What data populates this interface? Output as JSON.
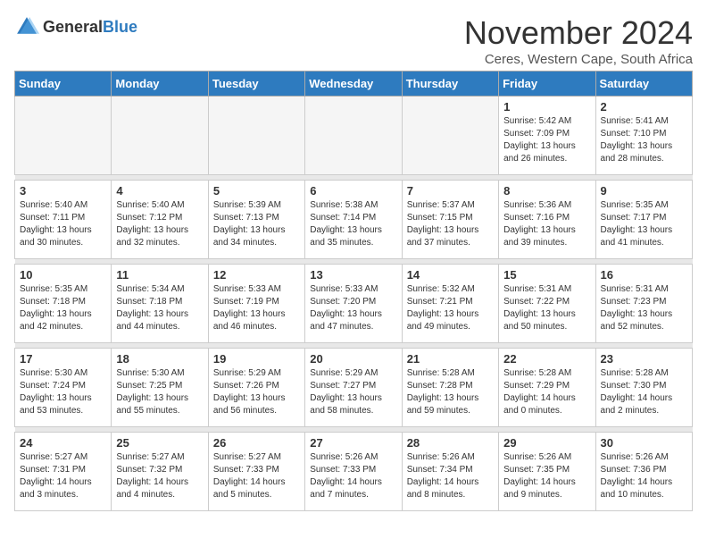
{
  "logo": {
    "general": "General",
    "blue": "Blue"
  },
  "header": {
    "month": "November 2024",
    "location": "Ceres, Western Cape, South Africa"
  },
  "weekdays": [
    "Sunday",
    "Monday",
    "Tuesday",
    "Wednesday",
    "Thursday",
    "Friday",
    "Saturday"
  ],
  "weeks": [
    [
      {
        "day": "",
        "info": ""
      },
      {
        "day": "",
        "info": ""
      },
      {
        "day": "",
        "info": ""
      },
      {
        "day": "",
        "info": ""
      },
      {
        "day": "",
        "info": ""
      },
      {
        "day": "1",
        "info": "Sunrise: 5:42 AM\nSunset: 7:09 PM\nDaylight: 13 hours\nand 26 minutes."
      },
      {
        "day": "2",
        "info": "Sunrise: 5:41 AM\nSunset: 7:10 PM\nDaylight: 13 hours\nand 28 minutes."
      }
    ],
    [
      {
        "day": "3",
        "info": "Sunrise: 5:40 AM\nSunset: 7:11 PM\nDaylight: 13 hours\nand 30 minutes."
      },
      {
        "day": "4",
        "info": "Sunrise: 5:40 AM\nSunset: 7:12 PM\nDaylight: 13 hours\nand 32 minutes."
      },
      {
        "day": "5",
        "info": "Sunrise: 5:39 AM\nSunset: 7:13 PM\nDaylight: 13 hours\nand 34 minutes."
      },
      {
        "day": "6",
        "info": "Sunrise: 5:38 AM\nSunset: 7:14 PM\nDaylight: 13 hours\nand 35 minutes."
      },
      {
        "day": "7",
        "info": "Sunrise: 5:37 AM\nSunset: 7:15 PM\nDaylight: 13 hours\nand 37 minutes."
      },
      {
        "day": "8",
        "info": "Sunrise: 5:36 AM\nSunset: 7:16 PM\nDaylight: 13 hours\nand 39 minutes."
      },
      {
        "day": "9",
        "info": "Sunrise: 5:35 AM\nSunset: 7:17 PM\nDaylight: 13 hours\nand 41 minutes."
      }
    ],
    [
      {
        "day": "10",
        "info": "Sunrise: 5:35 AM\nSunset: 7:18 PM\nDaylight: 13 hours\nand 42 minutes."
      },
      {
        "day": "11",
        "info": "Sunrise: 5:34 AM\nSunset: 7:18 PM\nDaylight: 13 hours\nand 44 minutes."
      },
      {
        "day": "12",
        "info": "Sunrise: 5:33 AM\nSunset: 7:19 PM\nDaylight: 13 hours\nand 46 minutes."
      },
      {
        "day": "13",
        "info": "Sunrise: 5:33 AM\nSunset: 7:20 PM\nDaylight: 13 hours\nand 47 minutes."
      },
      {
        "day": "14",
        "info": "Sunrise: 5:32 AM\nSunset: 7:21 PM\nDaylight: 13 hours\nand 49 minutes."
      },
      {
        "day": "15",
        "info": "Sunrise: 5:31 AM\nSunset: 7:22 PM\nDaylight: 13 hours\nand 50 minutes."
      },
      {
        "day": "16",
        "info": "Sunrise: 5:31 AM\nSunset: 7:23 PM\nDaylight: 13 hours\nand 52 minutes."
      }
    ],
    [
      {
        "day": "17",
        "info": "Sunrise: 5:30 AM\nSunset: 7:24 PM\nDaylight: 13 hours\nand 53 minutes."
      },
      {
        "day": "18",
        "info": "Sunrise: 5:30 AM\nSunset: 7:25 PM\nDaylight: 13 hours\nand 55 minutes."
      },
      {
        "day": "19",
        "info": "Sunrise: 5:29 AM\nSunset: 7:26 PM\nDaylight: 13 hours\nand 56 minutes."
      },
      {
        "day": "20",
        "info": "Sunrise: 5:29 AM\nSunset: 7:27 PM\nDaylight: 13 hours\nand 58 minutes."
      },
      {
        "day": "21",
        "info": "Sunrise: 5:28 AM\nSunset: 7:28 PM\nDaylight: 13 hours\nand 59 minutes."
      },
      {
        "day": "22",
        "info": "Sunrise: 5:28 AM\nSunset: 7:29 PM\nDaylight: 14 hours\nand 0 minutes."
      },
      {
        "day": "23",
        "info": "Sunrise: 5:28 AM\nSunset: 7:30 PM\nDaylight: 14 hours\nand 2 minutes."
      }
    ],
    [
      {
        "day": "24",
        "info": "Sunrise: 5:27 AM\nSunset: 7:31 PM\nDaylight: 14 hours\nand 3 minutes."
      },
      {
        "day": "25",
        "info": "Sunrise: 5:27 AM\nSunset: 7:32 PM\nDaylight: 14 hours\nand 4 minutes."
      },
      {
        "day": "26",
        "info": "Sunrise: 5:27 AM\nSunset: 7:33 PM\nDaylight: 14 hours\nand 5 minutes."
      },
      {
        "day": "27",
        "info": "Sunrise: 5:26 AM\nSunset: 7:33 PM\nDaylight: 14 hours\nand 7 minutes."
      },
      {
        "day": "28",
        "info": "Sunrise: 5:26 AM\nSunset: 7:34 PM\nDaylight: 14 hours\nand 8 minutes."
      },
      {
        "day": "29",
        "info": "Sunrise: 5:26 AM\nSunset: 7:35 PM\nDaylight: 14 hours\nand 9 minutes."
      },
      {
        "day": "30",
        "info": "Sunrise: 5:26 AM\nSunset: 7:36 PM\nDaylight: 14 hours\nand 10 minutes."
      }
    ]
  ]
}
